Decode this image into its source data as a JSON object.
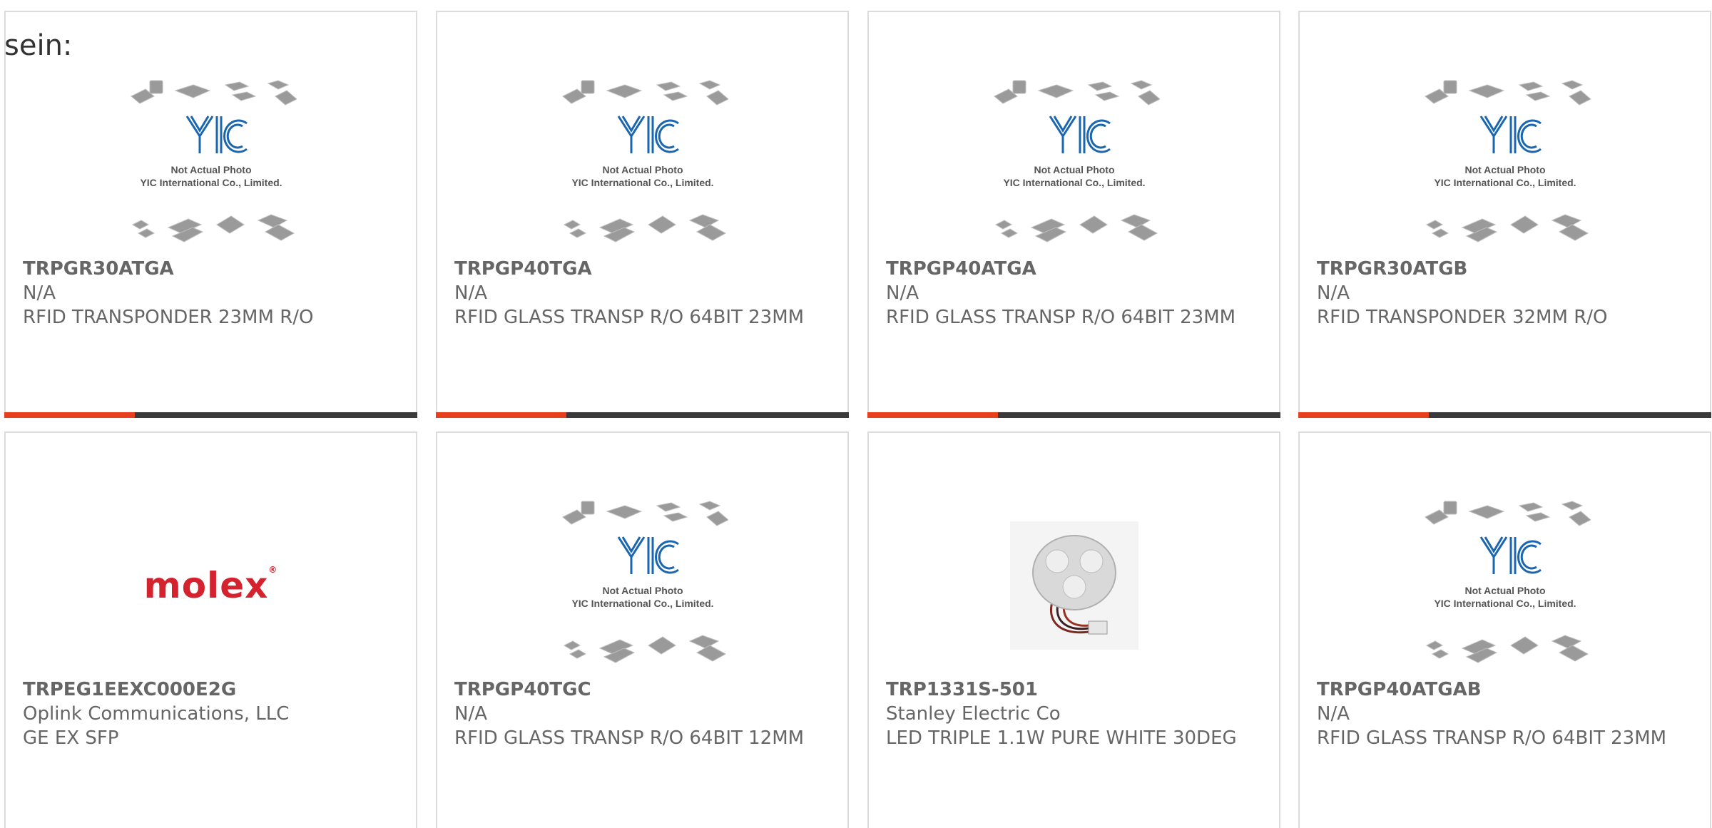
{
  "intro": "sein:",
  "placeholder": {
    "brand": "YIC",
    "line1": "Not Actual Photo",
    "line2": "YIC International Co., Limited."
  },
  "colors": {
    "accent": "#e8401c",
    "bar": "#3a3a3a",
    "molex_red": "#d4232e",
    "yic_blue": "#1a66b0"
  },
  "products": [
    {
      "part": "TRPGR30ATGA",
      "maker": "N/A",
      "desc": "RFID TRANSPONDER 23MM R/O",
      "image": "yic-placeholder"
    },
    {
      "part": "TRPGP40TGA",
      "maker": "N/A",
      "desc": "RFID GLASS TRANSP R/O 64BIT 23MM",
      "image": "yic-placeholder"
    },
    {
      "part": "TRPGP40ATGA",
      "maker": "N/A",
      "desc": "RFID GLASS TRANSP R/O 64BIT 23MM",
      "image": "yic-placeholder"
    },
    {
      "part": "TRPGR30ATGB",
      "maker": "N/A",
      "desc": "RFID TRANSPONDER 32MM R/O",
      "image": "yic-placeholder"
    },
    {
      "part": "TRPEG1EEXC000E2G",
      "maker": "Oplink Communications, LLC",
      "desc": "GE EX SFP",
      "image": "molex-logo",
      "logo_text": "molex"
    },
    {
      "part": "TRPGP40TGC",
      "maker": "N/A",
      "desc": "RFID GLASS TRANSP R/O 64BIT 12MM",
      "image": "yic-placeholder"
    },
    {
      "part": "TRP1331S-501",
      "maker": "Stanley Electric Co",
      "desc": "LED TRIPLE 1.1W PURE WHITE 30DEG",
      "image": "led-photo"
    },
    {
      "part": "TRPGP40ATGAB",
      "maker": "N/A",
      "desc": "RFID GLASS TRANSP R/O 64BIT 23MM",
      "image": "yic-placeholder"
    }
  ]
}
